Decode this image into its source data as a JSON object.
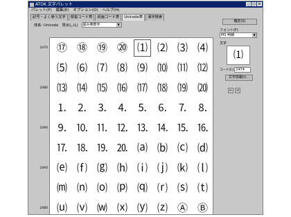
{
  "window": {
    "title": "ATOK 文字パレット",
    "buttons": [
      "_",
      "□",
      "×"
    ]
  },
  "menubar": [
    "パレット(P)",
    "編集(E)",
    "オプション(O)",
    "ヘルプ(H)"
  ],
  "tabs": [
    {
      "label": "記号・よく使う文字",
      "active": false
    },
    {
      "label": "部首コード表",
      "active": false
    },
    {
      "label": "総画コード表",
      "active": false
    },
    {
      "label": "Unicode表",
      "active": true
    },
    {
      "label": "漢字検索",
      "active": false
    }
  ],
  "controls": {
    "table_label": "体系: Unicode",
    "heading_label": "見出し(L)",
    "heading_value": "囲み英数字"
  },
  "grid": {
    "row_labels": [
      "2470",
      "2480",
      "2490",
      "24A0",
      "24B0"
    ],
    "cells": [
      "⑰",
      "⑱",
      "⑲",
      "⑳",
      "⑴",
      "⑵",
      "⑶",
      "⑷",
      "⑸",
      "⑹",
      "⑺",
      "⑻",
      "⑼",
      "⑽",
      "⑾",
      "⑿",
      "⒀",
      "⒁",
      "⒂",
      "⒃",
      "⒄",
      "⒅",
      "⒆",
      "⒇",
      "⒈",
      "⒉",
      "⒊",
      "⒋",
      "⒌",
      "⒍",
      "⒎",
      "⒏",
      "⒐",
      "⒑",
      "⒒",
      "⒓",
      "⒔",
      "⒕",
      "⒖",
      "⒗",
      "⒘",
      "⒙",
      "⒚",
      "⒛",
      "⒜",
      "⒝",
      "⒞",
      "⒟",
      "⒠",
      "⒡",
      "⒢",
      "⒣",
      "⒤",
      "⒥",
      "⒦",
      "⒧",
      "⒨",
      "⒩",
      "⒪",
      "⒫",
      "⒬",
      "⒭",
      "⒮",
      "⒯",
      "⒰",
      "⒱",
      "⒲",
      "⒳",
      "⒴",
      "⒵",
      "Ⓐ",
      "Ⓑ"
    ],
    "selected_index": 4
  },
  "panel": {
    "confirm_button": "確定(S)",
    "font_label": "フォント(F)",
    "font_value": "MS 明朝",
    "char_label": "文字",
    "preview_char": "⑴",
    "code_label": "コード(C)",
    "code_value": "2474",
    "info_button": "文字情報(I)...",
    "small_buttons": [
      "←",
      "→"
    ]
  }
}
